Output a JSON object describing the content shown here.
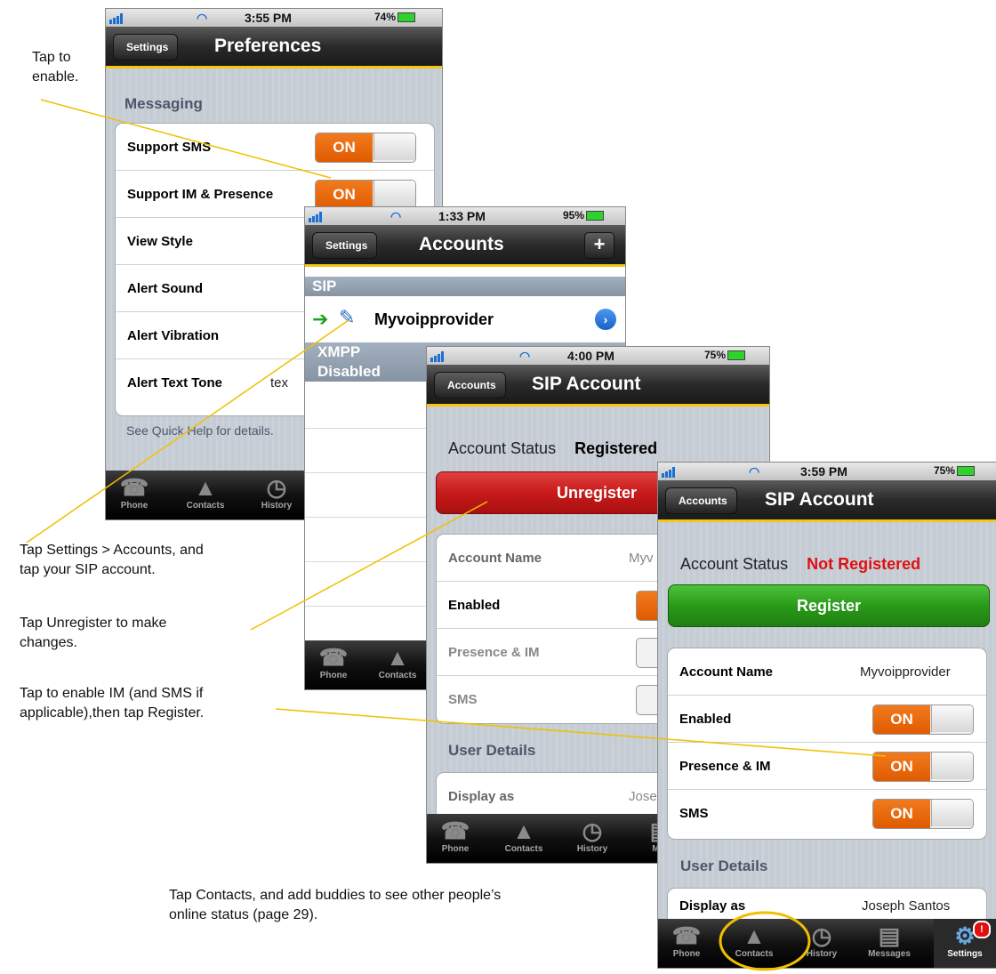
{
  "screen1": {
    "status": {
      "time": "3:55 PM",
      "battery": "74%"
    },
    "back": "Settings",
    "title": "Preferences",
    "section": "Messaging",
    "rows": [
      {
        "label": "Support SMS",
        "toggle": "ON"
      },
      {
        "label": "Support IM & Presence",
        "toggle": "ON"
      },
      {
        "label": "View Style"
      },
      {
        "label": "Alert Sound"
      },
      {
        "label": "Alert Vibration"
      },
      {
        "label": "Alert Text Tone",
        "value": "tex"
      }
    ],
    "footer": "See Quick Help for details.",
    "tabs": [
      "Phone",
      "Contacts",
      "History"
    ]
  },
  "screen2": {
    "status": {
      "time": "1:33 PM",
      "battery": "95%"
    },
    "back": "Settings",
    "title": "Accounts",
    "add": "+",
    "sip_header": "SIP",
    "account": "Myvoipprovider",
    "xmpp_header": "XMPP",
    "disabled": "Disabled",
    "tabs": [
      "Phone",
      "Contacts"
    ]
  },
  "screen3": {
    "status": {
      "time": "4:00 PM",
      "battery": "75%"
    },
    "back": "Accounts",
    "title": "SIP Account",
    "status_label": "Account Status",
    "status_value": "Registered",
    "button": "Unregister",
    "rows": [
      {
        "label": "Account Name",
        "value": "Myv"
      },
      {
        "label": "Enabled",
        "toggle": "O"
      },
      {
        "label": "Presence & IM"
      },
      {
        "label": "SMS"
      }
    ],
    "section": "User Details",
    "display_label": "Display as",
    "display_value": "Jose",
    "tabs": [
      "Phone",
      "Contacts",
      "History",
      "Mes"
    ]
  },
  "screen4": {
    "status": {
      "time": "3:59 PM",
      "battery": "75%"
    },
    "back": "Accounts",
    "title": "SIP Account",
    "status_label": "Account Status",
    "status_value": "Not Registered",
    "button": "Register",
    "rows": [
      {
        "label": "Account Name",
        "value": "Myvoipprovider"
      },
      {
        "label": "Enabled",
        "toggle": "ON"
      },
      {
        "label": "Presence & IM",
        "toggle": "ON"
      },
      {
        "label": "SMS",
        "toggle": "ON"
      }
    ],
    "section": "User Details",
    "display_label": "Display as",
    "display_value": "Joseph Santos",
    "tabs": [
      "Phone",
      "Contacts",
      "History",
      "Messages",
      "Settings"
    ]
  },
  "notes": {
    "n1": "Tap to\nenable.",
    "n2": "Tap Settings > Accounts, and\ntap your SIP account.",
    "n3": "Tap Unregister to make\nchanges.",
    "n4": "Tap to enable IM (and SMS if\napplicable),then tap Register.",
    "n5": "Tap Contacts, and add buddies to see other people’s\nonline status (page 29)."
  },
  "colors": {
    "accent": "#f4c514",
    "toggle_on": "#e8650a",
    "register": "#2a9a1a",
    "unregister": "#c81a1a",
    "not_registered": "#e01010"
  }
}
